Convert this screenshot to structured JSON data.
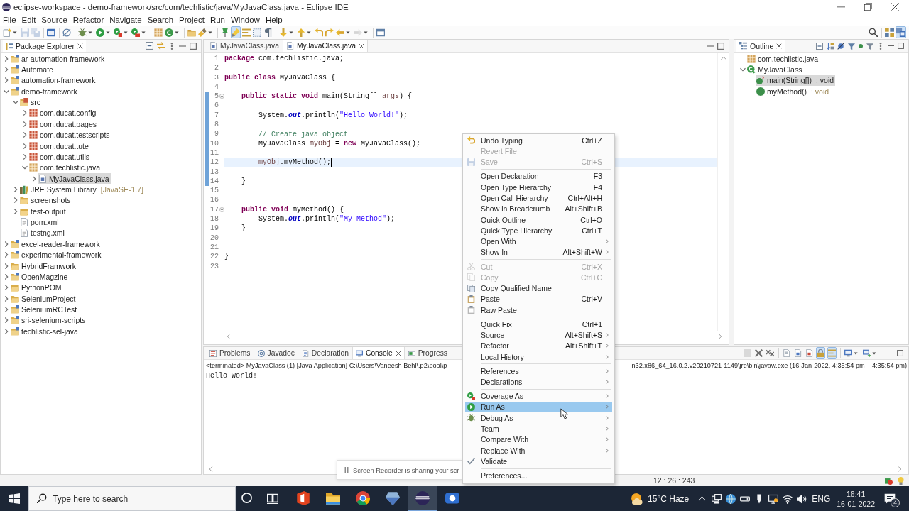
{
  "window": {
    "title": "eclipse-workspace - demo-framework/src/com/techlistic/java/MyJavaClass.java - Eclipse IDE"
  },
  "menu_bar": [
    "File",
    "Edit",
    "Source",
    "Refactor",
    "Navigate",
    "Search",
    "Project",
    "Run",
    "Window",
    "Help"
  ],
  "toolbar": {
    "groups": [
      [
        {
          "dropdown": true,
          "pressed": false,
          "disabled": false
        },
        {
          "dropdown": false,
          "pressed": false,
          "disabled": true
        },
        {
          "dropdown": false,
          "pressed": false,
          "disabled": true
        }
      ],
      [
        {
          "dropdown": false,
          "pressed": false,
          "disabled": false
        }
      ],
      [
        {
          "dropdown": false,
          "pressed": false,
          "disabled": false
        }
      ],
      [
        {
          "dropdown": true,
          "pressed": false,
          "disabled": false
        },
        {
          "dropdown": true,
          "pressed": false,
          "disabled": false
        },
        {
          "dropdown": true,
          "pressed": false,
          "disabled": false
        },
        {
          "dropdown": true,
          "pressed": false,
          "disabled": false
        }
      ],
      [
        {
          "dropdown": false,
          "pressed": false,
          "disabled": false
        },
        {
          "dropdown": true,
          "pressed": false,
          "disabled": false
        }
      ],
      [
        {
          "dropdown": false,
          "pressed": false,
          "disabled": false
        },
        {
          "dropdown": true,
          "pressed": false,
          "disabled": false
        }
      ],
      [
        {
          "dropdown": false,
          "pressed": false,
          "disabled": false
        },
        {
          "dropdown": false,
          "pressed": true,
          "disabled": false
        },
        {
          "dropdown": false,
          "pressed": false,
          "disabled": false
        },
        {
          "dropdown": false,
          "pressed": false,
          "disabled": false
        },
        {
          "dropdown": false,
          "pressed": false,
          "disabled": false
        }
      ],
      [
        {
          "dropdown": true,
          "pressed": false,
          "disabled": false
        },
        {
          "dropdown": true,
          "pressed": false,
          "disabled": false
        },
        {
          "dropdown": false,
          "pressed": false,
          "disabled": false
        },
        {
          "dropdown": false,
          "pressed": false,
          "disabled": false
        },
        {
          "dropdown": true,
          "pressed": false,
          "disabled": false
        },
        {
          "dropdown": true,
          "pressed": false,
          "disabled": true
        }
      ],
      [
        {
          "dropdown": false,
          "pressed": false,
          "disabled": false
        }
      ]
    ],
    "right": [
      {
        "pressed": false
      },
      {
        "pressed": false
      },
      {
        "pressed": true
      }
    ]
  },
  "package_explorer": {
    "title": "Package Explorer",
    "items": [
      {
        "label": "ar-automation-framework",
        "kind": "java-project",
        "expanded": false,
        "selected": false
      },
      {
        "label": "Automate",
        "kind": "java-project",
        "expanded": false,
        "selected": false
      },
      {
        "label": "automation-framework",
        "kind": "java-project",
        "expanded": false,
        "selected": false
      },
      {
        "label": "demo-framework",
        "kind": "java-project",
        "expanded": true,
        "selected": false,
        "children": [
          {
            "label": "src",
            "kind": "source-folder",
            "expanded": true,
            "selected": false,
            "children": [
              {
                "label": "com.ducat.config",
                "kind": "error-package",
                "expanded": false,
                "selected": false
              },
              {
                "label": "com.ducat.pages",
                "kind": "error-package",
                "expanded": false,
                "selected": false
              },
              {
                "label": "com.ducat.testscripts",
                "kind": "error-package",
                "expanded": false,
                "selected": false
              },
              {
                "label": "com.ducat.tute",
                "kind": "error-package",
                "expanded": false,
                "selected": false
              },
              {
                "label": "com.ducat.utils",
                "kind": "error-package",
                "expanded": false,
                "selected": false
              },
              {
                "label": "com.techlistic.java",
                "kind": "package",
                "expanded": true,
                "selected": false,
                "children": [
                  {
                    "label": "MyJavaClass.java",
                    "kind": "java-file",
                    "expanded": false,
                    "selected": true
                  }
                ]
              }
            ]
          },
          {
            "label": "JRE System Library",
            "decoration": "[JavaSE-1.7]",
            "kind": "library",
            "expanded": false,
            "selected": false
          },
          {
            "label": "screenshots",
            "kind": "folder",
            "expanded": false,
            "selected": false
          },
          {
            "label": "test-output",
            "kind": "folder",
            "expanded": false,
            "selected": false
          },
          {
            "label": "pom.xml",
            "kind": "file",
            "selected": false
          },
          {
            "label": "testng.xml",
            "kind": "file",
            "selected": false
          }
        ]
      },
      {
        "label": "excel-reader-framework",
        "kind": "java-project",
        "expanded": false,
        "selected": false
      },
      {
        "label": "experimental-framework",
        "kind": "java-project",
        "expanded": false,
        "selected": false
      },
      {
        "label": "HybridFramwork",
        "kind": "project",
        "expanded": false,
        "selected": false
      },
      {
        "label": "OpenMagzine",
        "kind": "java-project",
        "expanded": false,
        "selected": false
      },
      {
        "label": "PythonPOM",
        "kind": "project",
        "expanded": false,
        "selected": false
      },
      {
        "label": "SeleniumProject",
        "kind": "project",
        "expanded": false,
        "selected": false
      },
      {
        "label": "SeleniumRCTest",
        "kind": "java-project",
        "expanded": false,
        "selected": false
      },
      {
        "label": "sri-selenium-scripts",
        "kind": "java-project",
        "expanded": false,
        "selected": false
      },
      {
        "label": "techlistic-sel-java",
        "kind": "java-project",
        "expanded": false,
        "selected": false
      }
    ]
  },
  "editor": {
    "tabs": [
      {
        "label": "MyJavaClass.java",
        "selected": false
      },
      {
        "label": "MyJavaClass.java",
        "selected": true
      }
    ],
    "lines": [
      {
        "number": "1",
        "changed": false,
        "current": false,
        "foldable": false,
        "tokens": [
          {
            "kind": "keyword",
            "text": "package"
          },
          {
            "kind": "plain",
            "text": " com.techlistic.java;"
          }
        ]
      },
      {
        "number": "2",
        "changed": false,
        "current": false,
        "foldable": false
      },
      {
        "number": "3",
        "changed": false,
        "current": false,
        "foldable": false,
        "tokens": [
          {
            "kind": "keyword",
            "text": "public class"
          },
          {
            "kind": "plain",
            "text": " MyJavaClass {"
          }
        ]
      },
      {
        "number": "4",
        "changed": false,
        "current": false,
        "foldable": false
      },
      {
        "number": "5",
        "changed": true,
        "current": false,
        "foldable": true,
        "tokens": [
          {
            "kind": "keyword",
            "text": "    public static void"
          },
          {
            "kind": "plain",
            "text": " main(String[] "
          },
          {
            "kind": "local",
            "text": "args"
          },
          {
            "kind": "plain",
            "text": ") {"
          }
        ]
      },
      {
        "number": "6",
        "changed": true,
        "current": false,
        "foldable": false
      },
      {
        "number": "7",
        "changed": true,
        "current": false,
        "foldable": false,
        "tokens": [
          {
            "kind": "plain",
            "text": "        System."
          },
          {
            "kind": "field",
            "text": "out"
          },
          {
            "kind": "plain",
            "text": ".println("
          },
          {
            "kind": "string",
            "text": "\"Hello World!\""
          },
          {
            "kind": "plain",
            "text": ");"
          }
        ]
      },
      {
        "number": "8",
        "changed": true,
        "current": false,
        "foldable": false
      },
      {
        "number": "9",
        "changed": true,
        "current": false,
        "foldable": false,
        "tokens": [
          {
            "kind": "comment",
            "text": "        // Create java object"
          }
        ]
      },
      {
        "number": "10",
        "changed": true,
        "current": false,
        "foldable": false,
        "tokens": [
          {
            "kind": "plain",
            "text": "        MyJavaClass "
          },
          {
            "kind": "local",
            "text": "myObj"
          },
          {
            "kind": "plain",
            "text": " = "
          },
          {
            "kind": "keyword",
            "text": "new"
          },
          {
            "kind": "plain",
            "text": " MyJavaClass();"
          }
        ]
      },
      {
        "number": "11",
        "changed": true,
        "current": false,
        "foldable": false
      },
      {
        "number": "12",
        "changed": true,
        "current": true,
        "foldable": false,
        "tokens": [
          {
            "kind": "local",
            "text": "        myObj"
          },
          {
            "kind": "plain",
            "text": ".myMethod();"
          }
        ]
      },
      {
        "number": "13",
        "changed": true,
        "current": false,
        "foldable": false
      },
      {
        "number": "14",
        "changed": true,
        "current": false,
        "foldable": false,
        "tokens": [
          {
            "kind": "plain",
            "text": "    }"
          }
        ]
      },
      {
        "number": "15",
        "changed": false,
        "current": false,
        "foldable": false
      },
      {
        "number": "16",
        "changed": false,
        "current": false,
        "foldable": false
      },
      {
        "number": "17",
        "changed": false,
        "current": false,
        "foldable": true,
        "tokens": [
          {
            "kind": "keyword",
            "text": "    public void"
          },
          {
            "kind": "plain",
            "text": " myMethod() {"
          }
        ]
      },
      {
        "number": "18",
        "changed": false,
        "current": false,
        "foldable": false,
        "tokens": [
          {
            "kind": "plain",
            "text": "        System."
          },
          {
            "kind": "field",
            "text": "out"
          },
          {
            "kind": "plain",
            "text": ".println("
          },
          {
            "kind": "string",
            "text": "\"My Method\""
          },
          {
            "kind": "plain",
            "text": ");"
          }
        ]
      },
      {
        "number": "19",
        "changed": false,
        "current": false,
        "foldable": false,
        "tokens": [
          {
            "kind": "plain",
            "text": "    }"
          }
        ]
      },
      {
        "number": "20",
        "changed": false,
        "current": false,
        "foldable": false
      },
      {
        "number": "21",
        "changed": false,
        "current": false,
        "foldable": false
      },
      {
        "number": "22",
        "changed": false,
        "current": false,
        "foldable": false,
        "tokens": [
          {
            "kind": "plain",
            "text": "}"
          }
        ]
      },
      {
        "number": "23",
        "changed": false,
        "current": false,
        "foldable": false
      }
    ]
  },
  "outline": {
    "title": "Outline",
    "items": [
      {
        "label": "com.techlistic.java",
        "kind": "package",
        "selected": false
      },
      {
        "label": "MyJavaClass",
        "kind": "class",
        "expanded": true,
        "selected": false,
        "children": [
          {
            "label": "main(String[])",
            "return_type": ": void",
            "kind": "static-method",
            "selected": true
          },
          {
            "label": "myMethod()",
            "return_type": ": void",
            "kind": "method",
            "selected": false
          }
        ]
      }
    ]
  },
  "console_view": {
    "tabs": [
      {
        "label": "Problems",
        "selected": false
      },
      {
        "label": "Javadoc",
        "selected": false
      },
      {
        "label": "Declaration",
        "selected": false
      },
      {
        "label": "Console",
        "selected": true
      },
      {
        "label": "Progress",
        "selected": false
      }
    ],
    "toolbar": [
      {
        "dropdown": false,
        "pressed": false,
        "disabled": true
      },
      {
        "dropdown": false,
        "pressed": false,
        "disabled": false
      },
      {
        "dropdown": false,
        "pressed": false,
        "disabled": false
      },
      {
        "dropdown": false,
        "pressed": false,
        "disabled": false
      },
      {
        "dropdown": false,
        "pressed": false,
        "disabled": false
      },
      {
        "dropdown": false,
        "pressed": false,
        "disabled": false
      },
      {
        "dropdown": false,
        "pressed": true,
        "disabled": false
      },
      {
        "dropdown": false,
        "pressed": true,
        "disabled": false
      },
      {
        "dropdown": true,
        "pressed": false,
        "disabled": false
      },
      {
        "dropdown": true,
        "pressed": false,
        "disabled": false
      }
    ],
    "process": [
      "<terminated> MyJavaClass (1) [Java Application] C:\\Users\\Vaneesh Behl\\.p2\\pool\\p",
      "in32.x86_64_16.0.2.v20210721-1149\\jre\\bin\\javaw.exe  (16-Jan-2022, 4:35:54 pm – 4:35:54 pm)"
    ],
    "output": [
      "Hello World!"
    ]
  },
  "status_bar": {
    "position": "12 : 26 : 243"
  },
  "context_menu": {
    "sections": [
      [
        {
          "label": "Undo Typing",
          "shortcut": "Ctrl+Z",
          "submenu": false,
          "disabled": false,
          "selected": false
        },
        {
          "label": "Revert File",
          "submenu": false,
          "disabled": true,
          "selected": false
        },
        {
          "label": "Save",
          "shortcut": "Ctrl+S",
          "submenu": false,
          "disabled": true,
          "selected": false
        }
      ],
      [
        {
          "label": "Open Declaration",
          "shortcut": "F3",
          "submenu": false,
          "disabled": false,
          "selected": false
        },
        {
          "label": "Open Type Hierarchy",
          "shortcut": "F4",
          "submenu": false,
          "disabled": false,
          "selected": false
        },
        {
          "label": "Open Call Hierarchy",
          "shortcut": "Ctrl+Alt+H",
          "submenu": false,
          "disabled": false,
          "selected": false
        },
        {
          "label": "Show in Breadcrumb",
          "shortcut": "Alt+Shift+B",
          "submenu": false,
          "disabled": false,
          "selected": false
        },
        {
          "label": "Quick Outline",
          "shortcut": "Ctrl+O",
          "submenu": false,
          "disabled": false,
          "selected": false
        },
        {
          "label": "Quick Type Hierarchy",
          "shortcut": "Ctrl+T",
          "submenu": false,
          "disabled": false,
          "selected": false
        },
        {
          "label": "Open With",
          "submenu": true,
          "disabled": false,
          "selected": false
        },
        {
          "label": "Show In",
          "shortcut": "Alt+Shift+W",
          "submenu": true,
          "disabled": false,
          "selected": false
        }
      ],
      [
        {
          "label": "Cut",
          "shortcut": "Ctrl+X",
          "submenu": false,
          "disabled": true,
          "selected": false
        },
        {
          "label": "Copy",
          "shortcut": "Ctrl+C",
          "submenu": false,
          "disabled": true,
          "selected": false
        },
        {
          "label": "Copy Qualified Name",
          "submenu": false,
          "disabled": false,
          "selected": false
        },
        {
          "label": "Paste",
          "shortcut": "Ctrl+V",
          "submenu": false,
          "disabled": false,
          "selected": false
        },
        {
          "label": "Raw Paste",
          "submenu": false,
          "disabled": false,
          "selected": false
        }
      ],
      [
        {
          "label": "Quick Fix",
          "shortcut": "Ctrl+1",
          "submenu": false,
          "disabled": false,
          "selected": false
        },
        {
          "label": "Source",
          "shortcut": "Alt+Shift+S",
          "submenu": true,
          "disabled": false,
          "selected": false
        },
        {
          "label": "Refactor",
          "shortcut": "Alt+Shift+T",
          "submenu": true,
          "disabled": false,
          "selected": false
        },
        {
          "label": "Local History",
          "submenu": true,
          "disabled": false,
          "selected": false
        }
      ],
      [
        {
          "label": "References",
          "submenu": true,
          "disabled": false,
          "selected": false
        },
        {
          "label": "Declarations",
          "submenu": true,
          "disabled": false,
          "selected": false
        }
      ],
      [
        {
          "label": "Coverage As",
          "submenu": true,
          "disabled": false,
          "selected": false
        },
        {
          "label": "Run As",
          "submenu": true,
          "disabled": false,
          "selected": true
        },
        {
          "label": "Debug As",
          "submenu": true,
          "disabled": false,
          "selected": false
        },
        {
          "label": "Team",
          "submenu": true,
          "disabled": false,
          "selected": false
        },
        {
          "label": "Compare With",
          "submenu": true,
          "disabled": false,
          "selected": false
        },
        {
          "label": "Replace With",
          "submenu": true,
          "disabled": false,
          "selected": false
        },
        {
          "label": "Validate",
          "submenu": false,
          "disabled": false,
          "selected": false
        }
      ],
      [
        {
          "label": "Preferences...",
          "submenu": false,
          "disabled": false,
          "selected": false
        }
      ]
    ]
  },
  "notification": {
    "text": "Screen Recorder is sharing your scr"
  },
  "taskbar": {
    "search": {
      "placeholder": "Type here to search"
    },
    "apps": [
      {
        "active": false
      },
      {
        "active": false
      },
      {
        "active": false
      },
      {
        "active": false
      },
      {
        "active": true
      },
      {
        "active": false
      }
    ],
    "weather": "15°C Haze",
    "language": "ENG",
    "time": "16:41",
    "date": "16-01-2022",
    "notification_count": "4"
  }
}
